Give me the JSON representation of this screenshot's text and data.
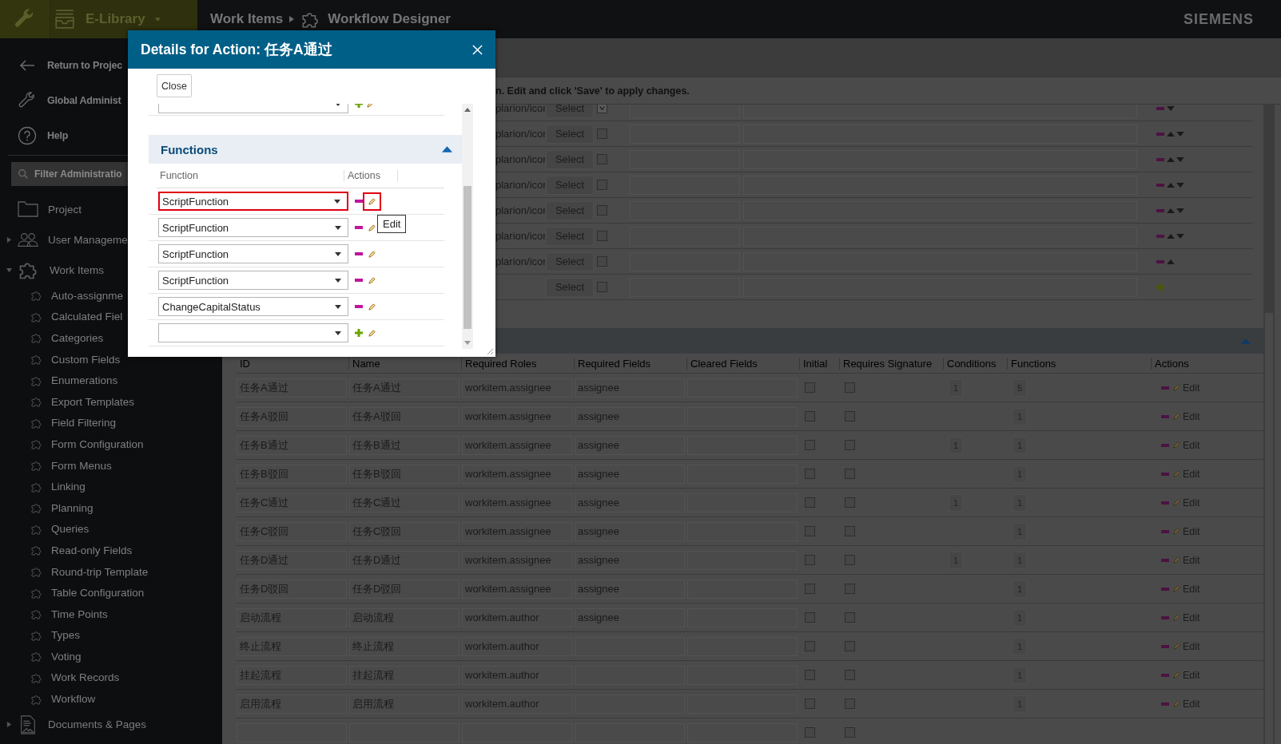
{
  "top_bar": {
    "library": "E-Library",
    "breadcrumb": [
      "Work Items",
      "Workflow Designer"
    ],
    "brand": "SIEMENS"
  },
  "sidebar": {
    "links": [
      {
        "label": "Return to Projec",
        "kind": "back"
      },
      {
        "label": "Global Administ",
        "kind": "wrench"
      },
      {
        "label": "Help",
        "kind": "help"
      }
    ],
    "filter": {
      "placeholder": "Filter Administratio"
    },
    "tree": [
      {
        "label": "Project",
        "kind": "folder"
      },
      {
        "label": "User Manageme",
        "kind": "users",
        "expanded": false
      },
      {
        "label": "Work Items",
        "kind": "puzzle",
        "expanded": true,
        "children": [
          {
            "label": "Auto-assignme"
          },
          {
            "label": "Calculated Fiel"
          },
          {
            "label": "Categories"
          },
          {
            "label": "Custom Fields"
          },
          {
            "label": "Enumerations"
          },
          {
            "label": "Export Templates"
          },
          {
            "label": "Field Filtering"
          },
          {
            "label": "Form Configuration"
          },
          {
            "label": "Form Menus"
          },
          {
            "label": "Linking"
          },
          {
            "label": "Planning"
          },
          {
            "label": "Queries"
          },
          {
            "label": "Read-only Fields"
          },
          {
            "label": "Round-trip Template"
          },
          {
            "label": "Table Configuration"
          },
          {
            "label": "Time Points"
          },
          {
            "label": "Types"
          },
          {
            "label": "Voting"
          },
          {
            "label": "Work Records"
          },
          {
            "label": "Workflow"
          }
        ]
      },
      {
        "label": "Documents & Pages",
        "kind": "document",
        "expanded": false
      }
    ]
  },
  "main": {
    "hint": "n. Edit and click 'Save' to apply changes.",
    "icon_rows": [
      {
        "kind": "existing",
        "path": "plarion/icor",
        "select": "Select",
        "checked": true,
        "up": false,
        "down": true
      },
      {
        "kind": "existing",
        "path": "plarion/icor",
        "select": "Select",
        "checked": false,
        "up": true,
        "down": true
      },
      {
        "kind": "existing",
        "path": "plarion/icor",
        "select": "Select",
        "checked": false,
        "up": true,
        "down": true
      },
      {
        "kind": "existing",
        "path": "plarion/icor",
        "select": "Select",
        "checked": false,
        "up": true,
        "down": true
      },
      {
        "kind": "existing",
        "path": "plarion/icor",
        "select": "Select",
        "checked": false,
        "up": true,
        "down": true
      },
      {
        "kind": "existing",
        "path": "plarion/icor",
        "select": "Select",
        "checked": false,
        "up": true,
        "down": true
      },
      {
        "kind": "existing",
        "path": "plarion/icor",
        "select": "Select",
        "checked": false,
        "up": true,
        "down": false
      },
      {
        "kind": "new",
        "select": "Select",
        "checked": false
      }
    ],
    "actions_section": {
      "expanded": true
    }
  },
  "actions_table": {
    "columns": [
      "ID",
      "Name",
      "Required Roles",
      "Required Fields",
      "Cleared Fields",
      "Initial",
      "Requires Signature",
      "Conditions",
      "Functions",
      "Actions"
    ],
    "rows": [
      {
        "kind": "existing",
        "id": "任务A通过",
        "name": "任务A通过",
        "roles": "workitem.assignee",
        "fields": "assignee",
        "initial": false,
        "requires_signature": false,
        "conditions": "1",
        "functions": "5",
        "edit": "Edit"
      },
      {
        "kind": "existing",
        "id": "任务A驳回",
        "name": "任务A驳回",
        "roles": "workitem.assignee",
        "fields": "assignee",
        "initial": false,
        "requires_signature": false,
        "functions": "1",
        "edit": "Edit"
      },
      {
        "kind": "existing",
        "id": "任务B通过",
        "name": "任务B通过",
        "roles": "workitem.assignee",
        "fields": "assignee",
        "initial": false,
        "requires_signature": false,
        "conditions": "1",
        "functions": "1",
        "edit": "Edit"
      },
      {
        "kind": "existing",
        "id": "任务B驳回",
        "name": "任务B驳回",
        "roles": "workitem.assignee",
        "fields": "assignee",
        "initial": false,
        "requires_signature": false,
        "functions": "1",
        "edit": "Edit"
      },
      {
        "kind": "existing",
        "id": "任务C通过",
        "name": "任务C通过",
        "roles": "workitem.assignee",
        "fields": "assignee",
        "initial": false,
        "requires_signature": false,
        "conditions": "1",
        "functions": "1",
        "edit": "Edit"
      },
      {
        "kind": "existing",
        "id": "任务C驳回",
        "name": "任务C驳回",
        "roles": "workitem.assignee",
        "fields": "assignee",
        "initial": false,
        "requires_signature": false,
        "functions": "1",
        "edit": "Edit"
      },
      {
        "kind": "existing",
        "id": "任务D通过",
        "name": "任务D通过",
        "roles": "workitem.assignee",
        "fields": "assignee",
        "initial": false,
        "requires_signature": false,
        "conditions": "1",
        "functions": "1",
        "edit": "Edit"
      },
      {
        "kind": "existing",
        "id": "任务D驳回",
        "name": "任务D驳回",
        "roles": "workitem.assignee",
        "fields": "assignee",
        "initial": false,
        "requires_signature": false,
        "functions": "1",
        "edit": "Edit"
      },
      {
        "kind": "existing",
        "id": "启动流程",
        "name": "启动流程",
        "roles": "workitem.author",
        "fields": "assignee",
        "initial": false,
        "requires_signature": false,
        "functions": "1",
        "edit": "Edit"
      },
      {
        "kind": "existing",
        "id": "终止流程",
        "name": "终止流程",
        "roles": "workitem.author",
        "initial": false,
        "requires_signature": false,
        "functions": "1",
        "edit": "Edit"
      },
      {
        "kind": "existing",
        "id": "挂起流程",
        "name": "挂起流程",
        "roles": "workitem.author",
        "initial": false,
        "requires_signature": false,
        "functions": "1",
        "edit": "Edit"
      },
      {
        "kind": "existing",
        "id": "启用流程",
        "name": "启用流程",
        "roles": "workitem.author",
        "initial": false,
        "requires_signature": false,
        "functions": "1",
        "edit": "Edit"
      },
      {
        "kind": "blank",
        "initial": false,
        "requires_signature": false
      }
    ]
  },
  "dialog": {
    "title": "Details for Action: 任务A通过",
    "close_button": "Close",
    "previous_row": {
      "kind": "new"
    },
    "section": {
      "title": "Functions",
      "expanded": true,
      "columns": [
        "Function",
        "Actions"
      ],
      "rows": [
        {
          "kind": "existing",
          "value": "ScriptFunction",
          "highlighted": true
        },
        {
          "kind": "existing",
          "value": "ScriptFunction",
          "highlighted": false
        },
        {
          "kind": "existing",
          "value": "ScriptFunction",
          "highlighted": false
        },
        {
          "kind": "existing",
          "value": "ScriptFunction",
          "highlighted": false
        },
        {
          "kind": "existing",
          "value": "ChangeCapitalStatus",
          "highlighted": false
        },
        {
          "kind": "new",
          "highlighted": false
        }
      ]
    },
    "tooltip": "Edit"
  }
}
